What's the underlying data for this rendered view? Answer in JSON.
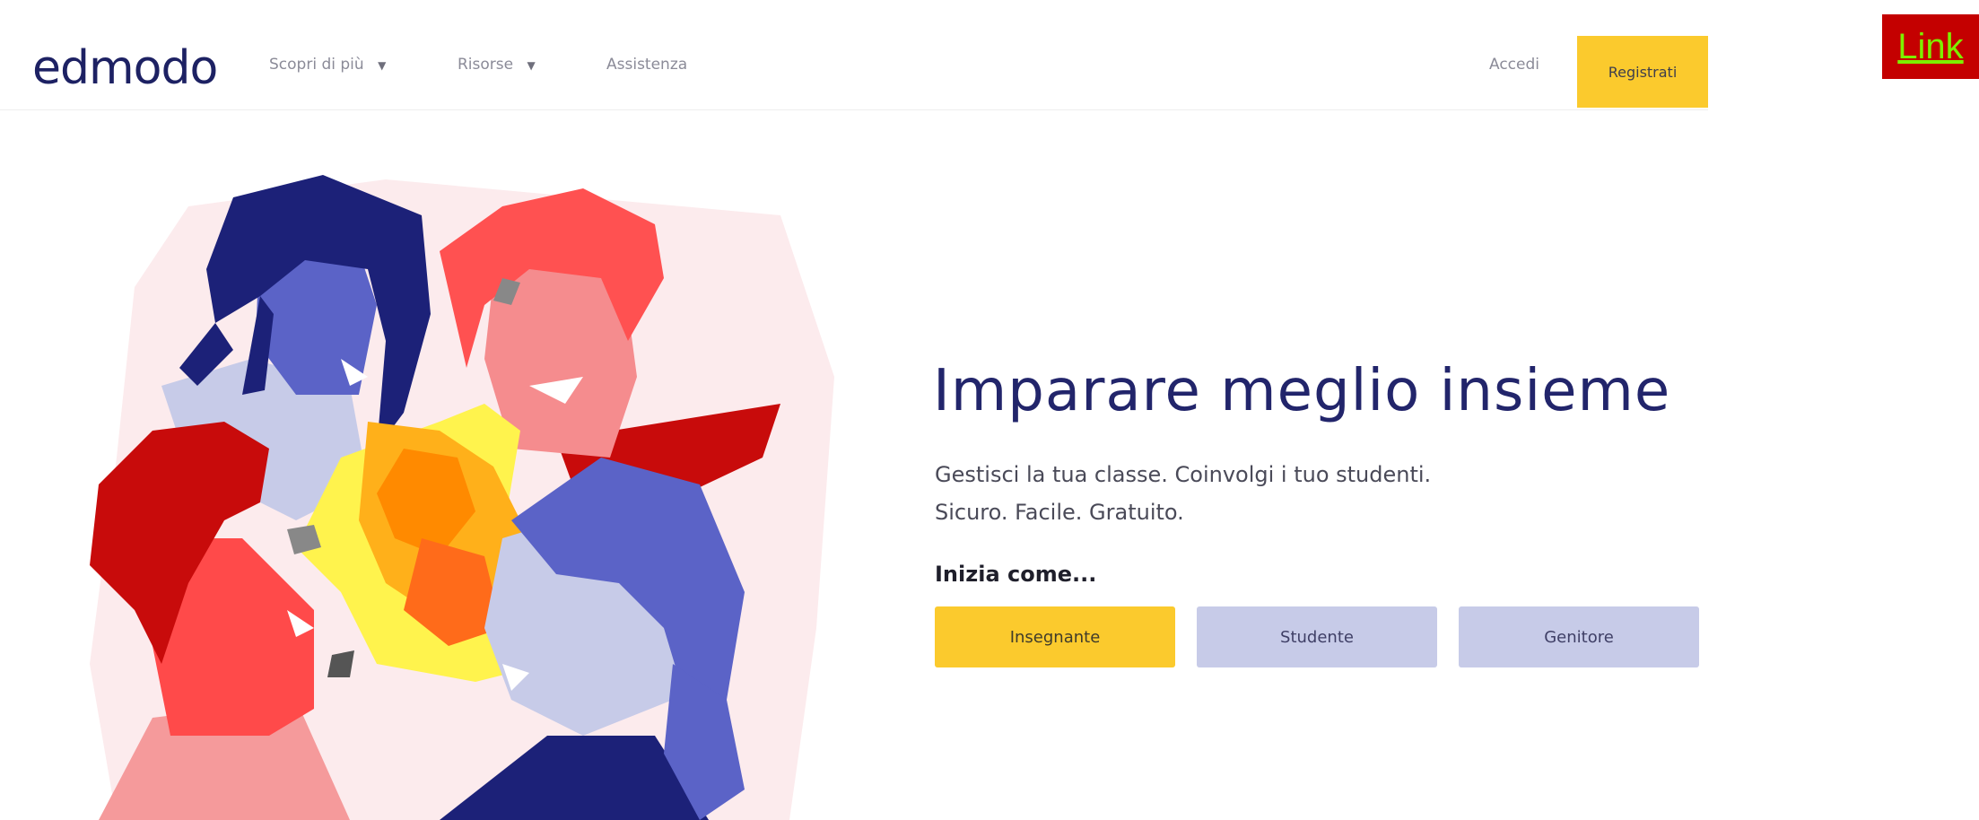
{
  "header": {
    "logo": "edmodo",
    "nav": [
      {
        "label": "Scopri di più",
        "caret": "▼"
      },
      {
        "label": "Risorse",
        "caret": "▼"
      },
      {
        "label": "Assistenza",
        "caret": ""
      }
    ],
    "login_label": "Accedi",
    "signup_label": "Registrati"
  },
  "corner_link": {
    "label": "Link"
  },
  "hero": {
    "title": "Imparare meglio insieme",
    "subtitle_line1": "Gestisci la tua classe. Coinvolgi i tuo studenti.",
    "subtitle_line2": "Sicuro. Facile. Gratuito.",
    "start_label": "Inizia come...",
    "roles": [
      {
        "label": "Insegnante"
      },
      {
        "label": "Studente"
      },
      {
        "label": "Genitore"
      }
    ]
  },
  "colors": {
    "accent_yellow": "#fbca2d",
    "brand_navy": "#1d2163",
    "lavender": "#c7cbe8",
    "link_bg": "#c40000",
    "link_text": "#7cf000"
  }
}
